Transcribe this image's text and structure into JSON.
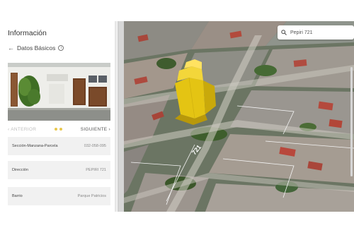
{
  "panel": {
    "title": "Información",
    "subtitle": "Datos Básicos",
    "carousel": {
      "prev_label": "ANTERIOR",
      "next_label": "SIGUIENTE"
    },
    "rows": [
      {
        "label": "Sección-Manzana-Parcela",
        "value": "032-058-095"
      },
      {
        "label": "Dirección",
        "value": "PEPIRI 721"
      },
      {
        "label": "Barrio",
        "value": "Parque Patricios"
      }
    ]
  },
  "map": {
    "street_label": "721",
    "building_color": "#f2d218"
  },
  "search": {
    "value": "Pepiri 721"
  },
  "icons": {
    "back": "arrow-left-icon",
    "info": "info-icon",
    "search": "search-icon",
    "prev": "chevron-left-icon",
    "next": "chevron-right-icon"
  }
}
